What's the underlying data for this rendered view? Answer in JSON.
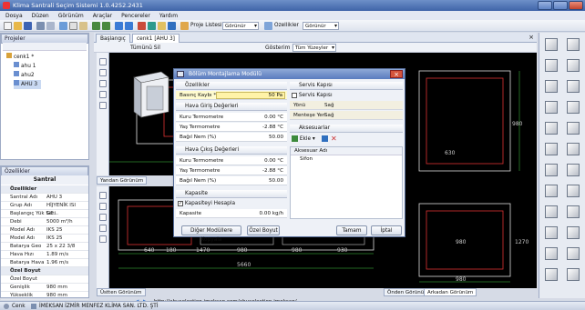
{
  "window": {
    "title": "Klima Santrali Seçim Sistemi 1.0.4252.2431"
  },
  "menu": [
    "Dosya",
    "Düzen",
    "Görünüm",
    "Araçlar",
    "Pencereler",
    "Yardım"
  ],
  "toolbar": {
    "proje_listesi": "Proje Listesi",
    "gorunur1": "Görünür",
    "ozellikler": "Özellikler",
    "gorunur2": "Görünür"
  },
  "project_panel": {
    "title": "Projeler",
    "tree": [
      "cenk1 *",
      "ahu 1",
      "ahu2",
      "AHU 3"
    ]
  },
  "props_panel": {
    "title": "Özellikler",
    "header": "Santral",
    "rows": [
      {
        "k": "Özellikler",
        "v": "",
        "cat": true
      },
      {
        "k": "Santral Adı",
        "v": "AHU 3"
      },
      {
        "k": "Grup Adı",
        "v": "HİJYENİK ISI GE..."
      },
      {
        "k": "Başlangıç Yük Seri",
        "v": ""
      },
      {
        "k": "Debi",
        "v": "5000 m³/h"
      },
      {
        "k": "Model Adı",
        "v": "IKS 25"
      },
      {
        "k": "Model Adı",
        "v": "IKS 25"
      },
      {
        "k": "Batarya Geo",
        "v": "25 x 22 3/8"
      },
      {
        "k": "Hava Hızı",
        "v": "1.89 m/s"
      },
      {
        "k": "Batarya Hava",
        "v": "1.96 m/s"
      },
      {
        "k": "Özel Boyut",
        "v": "",
        "cat": true
      },
      {
        "k": "Özel Boyut",
        "v": ""
      },
      {
        "k": "Genişlik",
        "v": "980 mm"
      },
      {
        "k": "Yükseklik",
        "v": "980 mm"
      }
    ]
  },
  "tabs": [
    "Başlangıç",
    "cenk1 [AHU 3]"
  ],
  "subbar": {
    "tumunu_sil": "Tümünü Sil",
    "gosterim": "Gösterim Biçimi",
    "tum_yuzeyler": "Tüm Yüzeyler"
  },
  "views": {
    "yandan": "Yandan Görünüm",
    "ustten": "Üstten Görünüm",
    "onden": "Önden Görünüm",
    "arkadan": "Arkadan Görünüm"
  },
  "dims": {
    "d640": "640",
    "d180": "180",
    "d1470": "1470",
    "d980a": "980",
    "d980b": "980",
    "d930": "930",
    "d5660": "5660",
    "d980c": "980",
    "d630": "630",
    "d980d": "980",
    "d900": "980",
    "d1270": "1270"
  },
  "dialog": {
    "title": "Bölüm Montajlama Modülü",
    "sec_ozellikler": "Özellikler",
    "basinc_label": "Basınç Kaybı *",
    "basinc_value": "50 Pa",
    "sec_giris": "Hava Giriş Değerleri",
    "giris": [
      {
        "k": "Kuru Termometre",
        "v": "0.00 °C"
      },
      {
        "k": "Yaş Termometre",
        "v": "-2.88 °C"
      },
      {
        "k": "Bağıl Nem (%)",
        "v": "50.00"
      }
    ],
    "sec_cikis": "Hava Çıkış Değerleri",
    "cikis": [
      {
        "k": "Kuru Termometre",
        "v": "0.00 °C"
      },
      {
        "k": "Yaş Termometre",
        "v": "-2.88 °C"
      },
      {
        "k": "Bağıl Nem (%)",
        "v": "50.00"
      }
    ],
    "sec_kapasite": "Kapasite",
    "kapasite_hesapla": "Kapasiteyi Hesapla",
    "kapasite_label": "Kapasite",
    "kapasite_value": "0.00 kg/h",
    "sec_servis": "Servis Kapısı",
    "servis_kapisi": "Servis Kapısı",
    "yonu_label": "Yönü",
    "yonu_value": "Sağ",
    "mentese_label": "Menteşe Yeri",
    "mentese_value": "Sağ",
    "sec_aksesuar": "Aksesuarlar",
    "ekle": "Ekle",
    "aks_header": "Aksesuar Adı",
    "aks_item": "Sifon",
    "btn_diger": "Diğer Modüllere Kopyala",
    "btn_ozel": "Özel Boyut",
    "btn_tamam": "Tamam",
    "btn_iptal": "İptal"
  },
  "address": "http://ahuselection.imeksan.com/ahuselection.imeksan/",
  "status": {
    "user": "Cenk",
    "company": "İMEKSAN İZMİR MENFEZ KLİMA SAN. LTD. ŞTİ"
  }
}
